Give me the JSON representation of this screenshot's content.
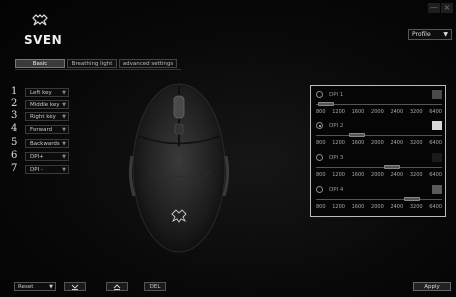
{
  "window": {
    "close_label": "×",
    "minimize_label": "—"
  },
  "brand": {
    "name": "SVEN",
    "logo_icon": "sven-logo-icon"
  },
  "profile": {
    "selected": "Profile",
    "arrow": "▼"
  },
  "tabs": [
    {
      "label": "Basic",
      "active": true
    },
    {
      "label": "Breathing light"
    },
    {
      "label": "advanced settings"
    }
  ],
  "buttons": [
    {
      "num": "1",
      "label": "Left key"
    },
    {
      "num": "2",
      "label": "Middle key"
    },
    {
      "num": "3",
      "label": "Right key"
    },
    {
      "num": "4",
      "label": "Forward"
    },
    {
      "num": "5",
      "label": "Backwards"
    },
    {
      "num": "6",
      "label": "DPI+"
    },
    {
      "num": "7",
      "label": "DPI -"
    }
  ],
  "dropdown_arrow": "▼",
  "dpi": {
    "ticks": [
      "800",
      "1200",
      "1600",
      "2000",
      "2400",
      "3200",
      "6400"
    ],
    "slots": [
      {
        "label": "DPI 1",
        "value_fraction": 0.02,
        "color": "#4a4a4a",
        "selected": false
      },
      {
        "label": "DPI 2",
        "value_fraction": 0.3,
        "color": "#d9d9d9",
        "selected": true
      },
      {
        "label": "DPI 3",
        "value_fraction": 0.62,
        "color": "#1a1a1a",
        "selected": false
      },
      {
        "label": "DPI 4",
        "value_fraction": 0.8,
        "color": "#5a5a5a",
        "selected": false
      }
    ]
  },
  "footer": {
    "profile_select": "Reset",
    "arrow": "▼",
    "import_icon": "import-icon",
    "export_icon": "export-icon",
    "third_label": "DEL",
    "apply_label": "Apply"
  }
}
